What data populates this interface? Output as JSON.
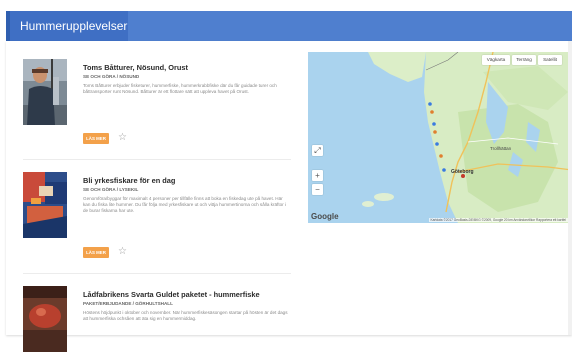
{
  "header": {
    "title": "Hummerupplevelser"
  },
  "items": [
    {
      "title": "Toms Båtturer, Nösund, Orust",
      "sub": "SE och göra / Nösund",
      "desc": "Toms Båtturer erbjuder fisketurer, hummerfiske, hummerkrabbfiske där du får guidade turer och båttransporter runt Nösund. Båtturer är ett flottare sätt att uppleva havet på Orust.",
      "button": "LÄS MER"
    },
    {
      "title": "Bli yrkesfiskare för en dag",
      "sub": "SE och göra / Lysekil",
      "desc": "Genomföra/byggar för maximalt 4 personer per tillfälle finns att boka en fiskedag ute på havet. Här kan du fiska lite hummer. Du får följa med yrkesfiskare ut och vittja hummertinorna och sålla kräftor i de burar fiskarna har ute.",
      "button": "LÄS MER"
    },
    {
      "title": "Lådfabrikens Svarta Guldet paketet - hummerfiske",
      "sub": "PAKET/ERBJUDANDE / GÖRHULTSHALL",
      "desc": "Höstens höjdpunkt i oktober och november. När hummerfiskesäsongen startar på hösten är det dags att hummerfiska ochsåen att äta sig en hummermiddag.",
      "button": "LÄS MER"
    }
  ],
  "map": {
    "buttons": [
      "Vägkarta",
      "Terräng",
      "Satellit"
    ],
    "controls": {
      "fullscreen": "⤢",
      "zoom_in": "+",
      "zoom_out": "−"
    },
    "google": "Google",
    "attribution": "Kartdata ©2017 GeoBasis-DE/BKG ©2009, Google   20 km   Användarvillkor   Rapportera ett kartfel",
    "labels": {
      "gothenburg": "Göteborg",
      "trollhattan": "Trollhättan"
    }
  },
  "colors": {
    "header": "#4f7fcf",
    "button": "#f3a14a"
  }
}
